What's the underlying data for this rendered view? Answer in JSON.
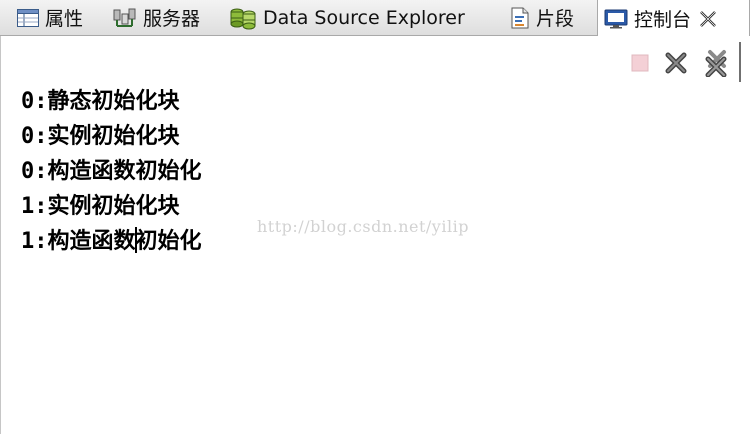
{
  "tabs": [
    {
      "label": "属性",
      "icon": "properties-icon"
    },
    {
      "label": "服务器",
      "icon": "servers-icon"
    },
    {
      "label": "Data Source Explorer",
      "icon": "data-source-icon"
    },
    {
      "label": "片段",
      "icon": "snippets-icon"
    },
    {
      "label": "控制台",
      "icon": "console-icon",
      "active": true
    }
  ],
  "toolbar": {
    "terminate_icon": "terminate-icon",
    "remove_launch_icon": "remove-launch-icon",
    "remove_all_icon": "remove-all-terminated-icon"
  },
  "console": {
    "lines": [
      "0:静态初始化块",
      "0:实例初始化块",
      "0:构造函数初始化",
      "1:实例初始化块",
      "1:构造函数初始化"
    ],
    "caret_line_prefix": "1:构造函数",
    "caret_line_suffix": "初始化"
  },
  "watermark": "http://blog.csdn.net/yilip",
  "colors": {
    "tab_bar": "#dedede",
    "border": "#a9a9a9",
    "text": "#000000",
    "watermark": "#d2d2d2",
    "console_icon_blue": "#2b5aa8"
  }
}
